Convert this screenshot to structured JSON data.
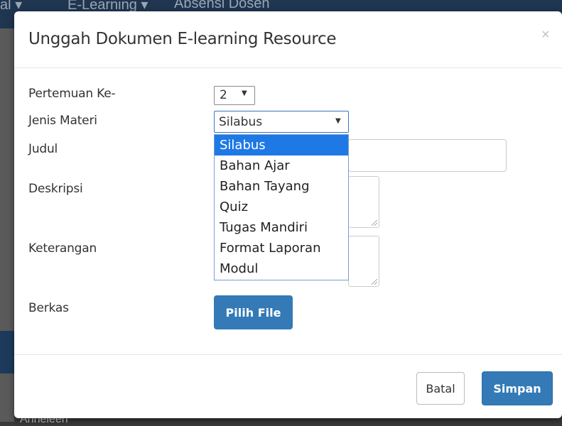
{
  "background": {
    "nav_items": [
      "al ▾",
      "E-Learning ▾",
      "Absensi Dosen"
    ],
    "bottom_text": "Anneleen"
  },
  "modal": {
    "title": "Unggah Dokumen E-learning Resource",
    "close_glyph": "×",
    "fields": {
      "pertemuan_label": "Pertemuan Ke-",
      "pertemuan_value": "2",
      "jenis_label": "Jenis Materi",
      "jenis_value": "Silabus",
      "judul_label": "Judul",
      "deskripsi_label": "Deskripsi",
      "keterangan_label": "Keterangan",
      "berkas_label": "Berkas"
    },
    "jenis_options": [
      "Silabus",
      "Bahan Ajar",
      "Bahan Tayang",
      "Quiz",
      "Tugas Mandiri",
      "Format Laporan",
      "Modul"
    ],
    "selected_option": "Silabus",
    "pilih_file_label": "Pilih File",
    "batal_label": "Batal",
    "simpan_label": "Simpan"
  },
  "colors": {
    "primary": "#337ab7",
    "dropdown_highlight": "#1e79e5"
  }
}
